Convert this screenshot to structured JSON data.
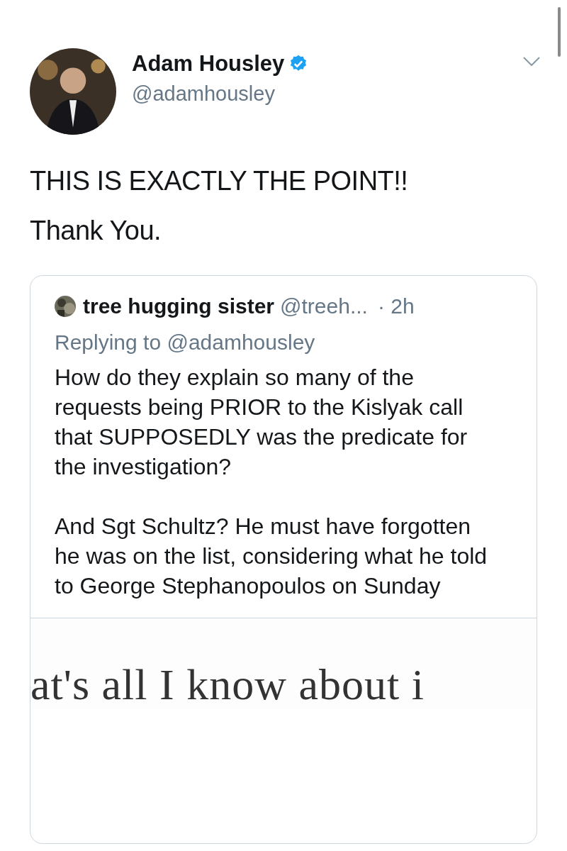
{
  "tweet": {
    "author": {
      "name": "Adam Housley",
      "verified": true,
      "handle": "@adamhousley"
    },
    "text_lines": [
      "THIS IS EXACTLY THE POINT!!",
      "Thank You."
    ],
    "quoted_tweet": {
      "author": {
        "name": "tree hugging sister",
        "handle": "@treeh...",
        "time": "· 2h"
      },
      "replying_to": "Replying to @adamhousley",
      "paragraphs": [
        "How do they explain so many of the requests being PRIOR to the Kislyak call that SUPPOSEDLY was the predicate for the investigation?",
        "And Sgt Schultz? He must have forgotten he was on the list, considering what he told to George Stephanopoulos on Sunday"
      ],
      "media": {
        "kind": "document",
        "text": "at's all I know about i"
      }
    }
  }
}
